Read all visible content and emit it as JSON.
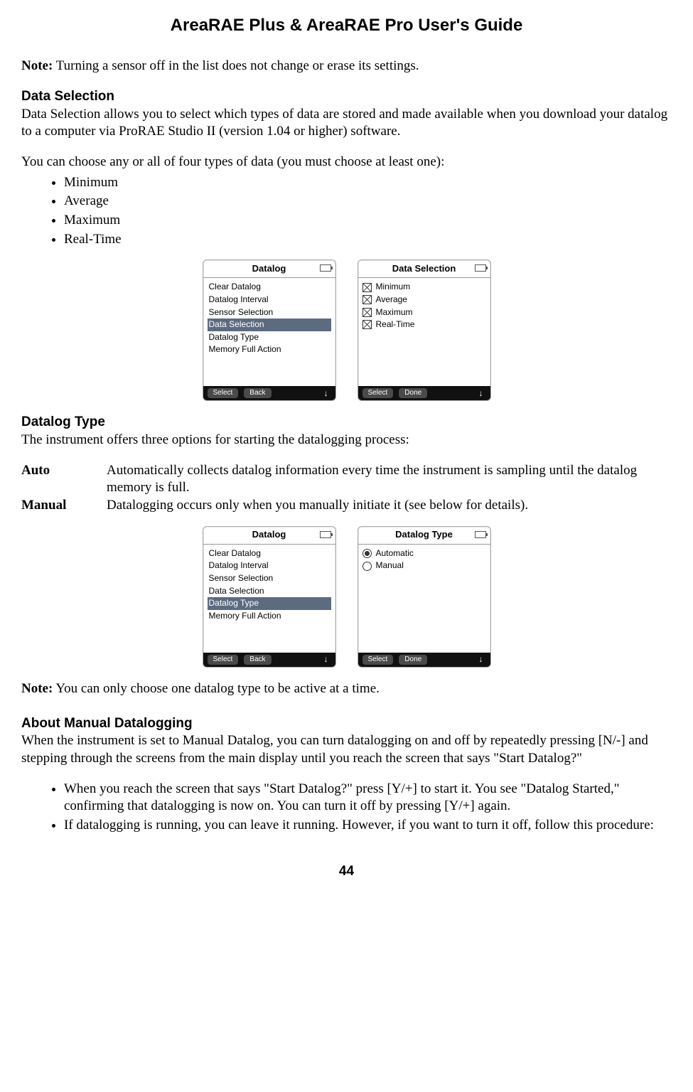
{
  "title": "AreaRAE Plus & AreaRAE Pro User's Guide",
  "note1_label": "Note:",
  "note1_text": " Turning a sensor off in the list does not change or erase its settings.",
  "data_selection": {
    "heading": "Data Selection",
    "p1": "Data Selection allows you to select which types of data are stored and made available when you download your datalog to a computer via ProRAE Studio II (version 1.04 or higher) software.",
    "p2": "You can choose any or all of four types of data (you must choose at least one):",
    "bullets": [
      "Minimum",
      "Average",
      "Maximum",
      "Real-Time"
    ]
  },
  "screens1": {
    "left": {
      "title": "Datalog",
      "items": [
        "Clear Datalog",
        "Datalog Interval",
        "Sensor Selection",
        "Data Selection",
        "Datalog Type",
        "Memory Full Action"
      ],
      "selected_index": 3,
      "btn1": "Select",
      "btn2": "Back"
    },
    "right": {
      "title": "Data Selection",
      "items": [
        "Minimum",
        "Average",
        "Maximum",
        "Real-Time"
      ],
      "btn1": "Select",
      "btn2": "Done"
    }
  },
  "datalog_type": {
    "heading": "Datalog Type",
    "intro": "The instrument offers three options for starting the datalogging process:",
    "auto_label": "Auto",
    "auto_text": "Automatically collects datalog information every time the instrument is sampling until the datalog memory is full.",
    "manual_label": "Manual",
    "manual_text": "Datalogging occurs only when you manually initiate it (see below for details)."
  },
  "screens2": {
    "left": {
      "title": "Datalog",
      "items": [
        "Clear Datalog",
        "Datalog Interval",
        "Sensor Selection",
        "Data Selection",
        "Datalog Type",
        "Memory Full Action"
      ],
      "selected_index": 4,
      "btn1": "Select",
      "btn2": "Back"
    },
    "right": {
      "title": "Datalog Type",
      "items": [
        "Automatic",
        "Manual"
      ],
      "selected_index": 0,
      "btn1": "Select",
      "btn2": "Done"
    }
  },
  "note2_label": "Note:",
  "note2_text": " You can only choose one datalog type to be active at a time.",
  "manual_datalog": {
    "heading": "About Manual Datalogging",
    "p1": "When the instrument is set to Manual Datalog, you can turn datalogging on and off by repeatedly pressing [N/-] and stepping through the screens from the main display until you reach the screen that says \"Start Datalog?\"",
    "b1": "When you reach the screen that says \"Start Datalog?\" press [Y/+] to start it. You see \"Datalog Started,\" confirming that datalogging is now on. You can turn it off by pressing [Y/+] again.",
    "b2": "If datalogging is running, you can leave it running. However, if you want to turn it off, follow this procedure:"
  },
  "page_number": "44"
}
